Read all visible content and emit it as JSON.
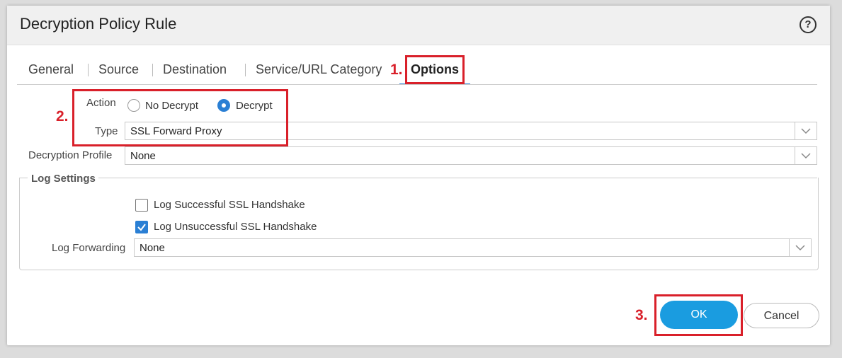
{
  "dialog": {
    "title": "Decryption Policy Rule",
    "help_icon": "question-circle-icon",
    "help_glyph": "?"
  },
  "tabs": [
    {
      "label": "General",
      "active": false
    },
    {
      "label": "Source",
      "active": false
    },
    {
      "label": "Destination",
      "active": false
    },
    {
      "label": "Service/URL Category",
      "active": false
    },
    {
      "label": "Options",
      "active": true
    }
  ],
  "options": {
    "action_label": "Action",
    "action_options": [
      {
        "label": "No Decrypt",
        "selected": false
      },
      {
        "label": "Decrypt",
        "selected": true
      }
    ],
    "type_label": "Type",
    "type_value": "SSL Forward Proxy",
    "profile_label": "Decryption Profile",
    "profile_value": "None"
  },
  "log_settings": {
    "legend": "Log Settings",
    "checkboxes": [
      {
        "label": "Log Successful SSL Handshake",
        "checked": false
      },
      {
        "label": "Log Unsuccessful SSL Handshake",
        "checked": true
      }
    ],
    "forwarding_label": "Log Forwarding",
    "forwarding_value": "None"
  },
  "footer": {
    "ok_label": "OK",
    "cancel_label": "Cancel"
  },
  "annotations": {
    "step1": "1.",
    "step2": "2.",
    "step3": "3."
  },
  "colors": {
    "accent": "#1a9ce0",
    "selected": "#2a7fd4",
    "annotation_red": "#d9202a"
  }
}
